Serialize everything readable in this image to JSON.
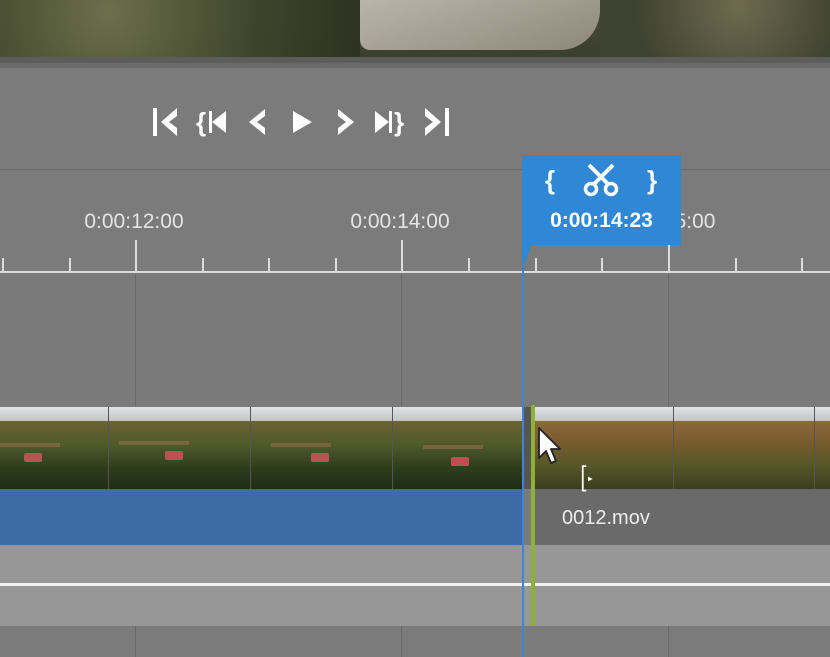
{
  "transport": {
    "buttons": [
      {
        "name": "go-to-start",
        "icon": "skip-to-start-icon"
      },
      {
        "name": "previous-marker",
        "icon": "previous-marker-icon"
      },
      {
        "name": "previous-frame",
        "icon": "chevron-left-icon"
      },
      {
        "name": "play",
        "icon": "play-icon"
      },
      {
        "name": "next-frame",
        "icon": "chevron-right-icon"
      },
      {
        "name": "next-marker",
        "icon": "next-marker-icon"
      },
      {
        "name": "go-to-end",
        "icon": "skip-to-end-icon"
      }
    ]
  },
  "ruler": {
    "labels": [
      "0:00:12:00",
      "0:00:14:00",
      "5:00"
    ]
  },
  "playhead": {
    "time": "0:00:14:23",
    "in_label": "{",
    "out_label": "}",
    "cut_icon": "scissors-icon"
  },
  "clips": {
    "next_clip_name": "0012.mov"
  },
  "colors": {
    "playhead": "#3d86d6",
    "popup": "#2f87d6",
    "selected_clip": "#3f6ba4",
    "cut_marker": "#8db32e"
  }
}
